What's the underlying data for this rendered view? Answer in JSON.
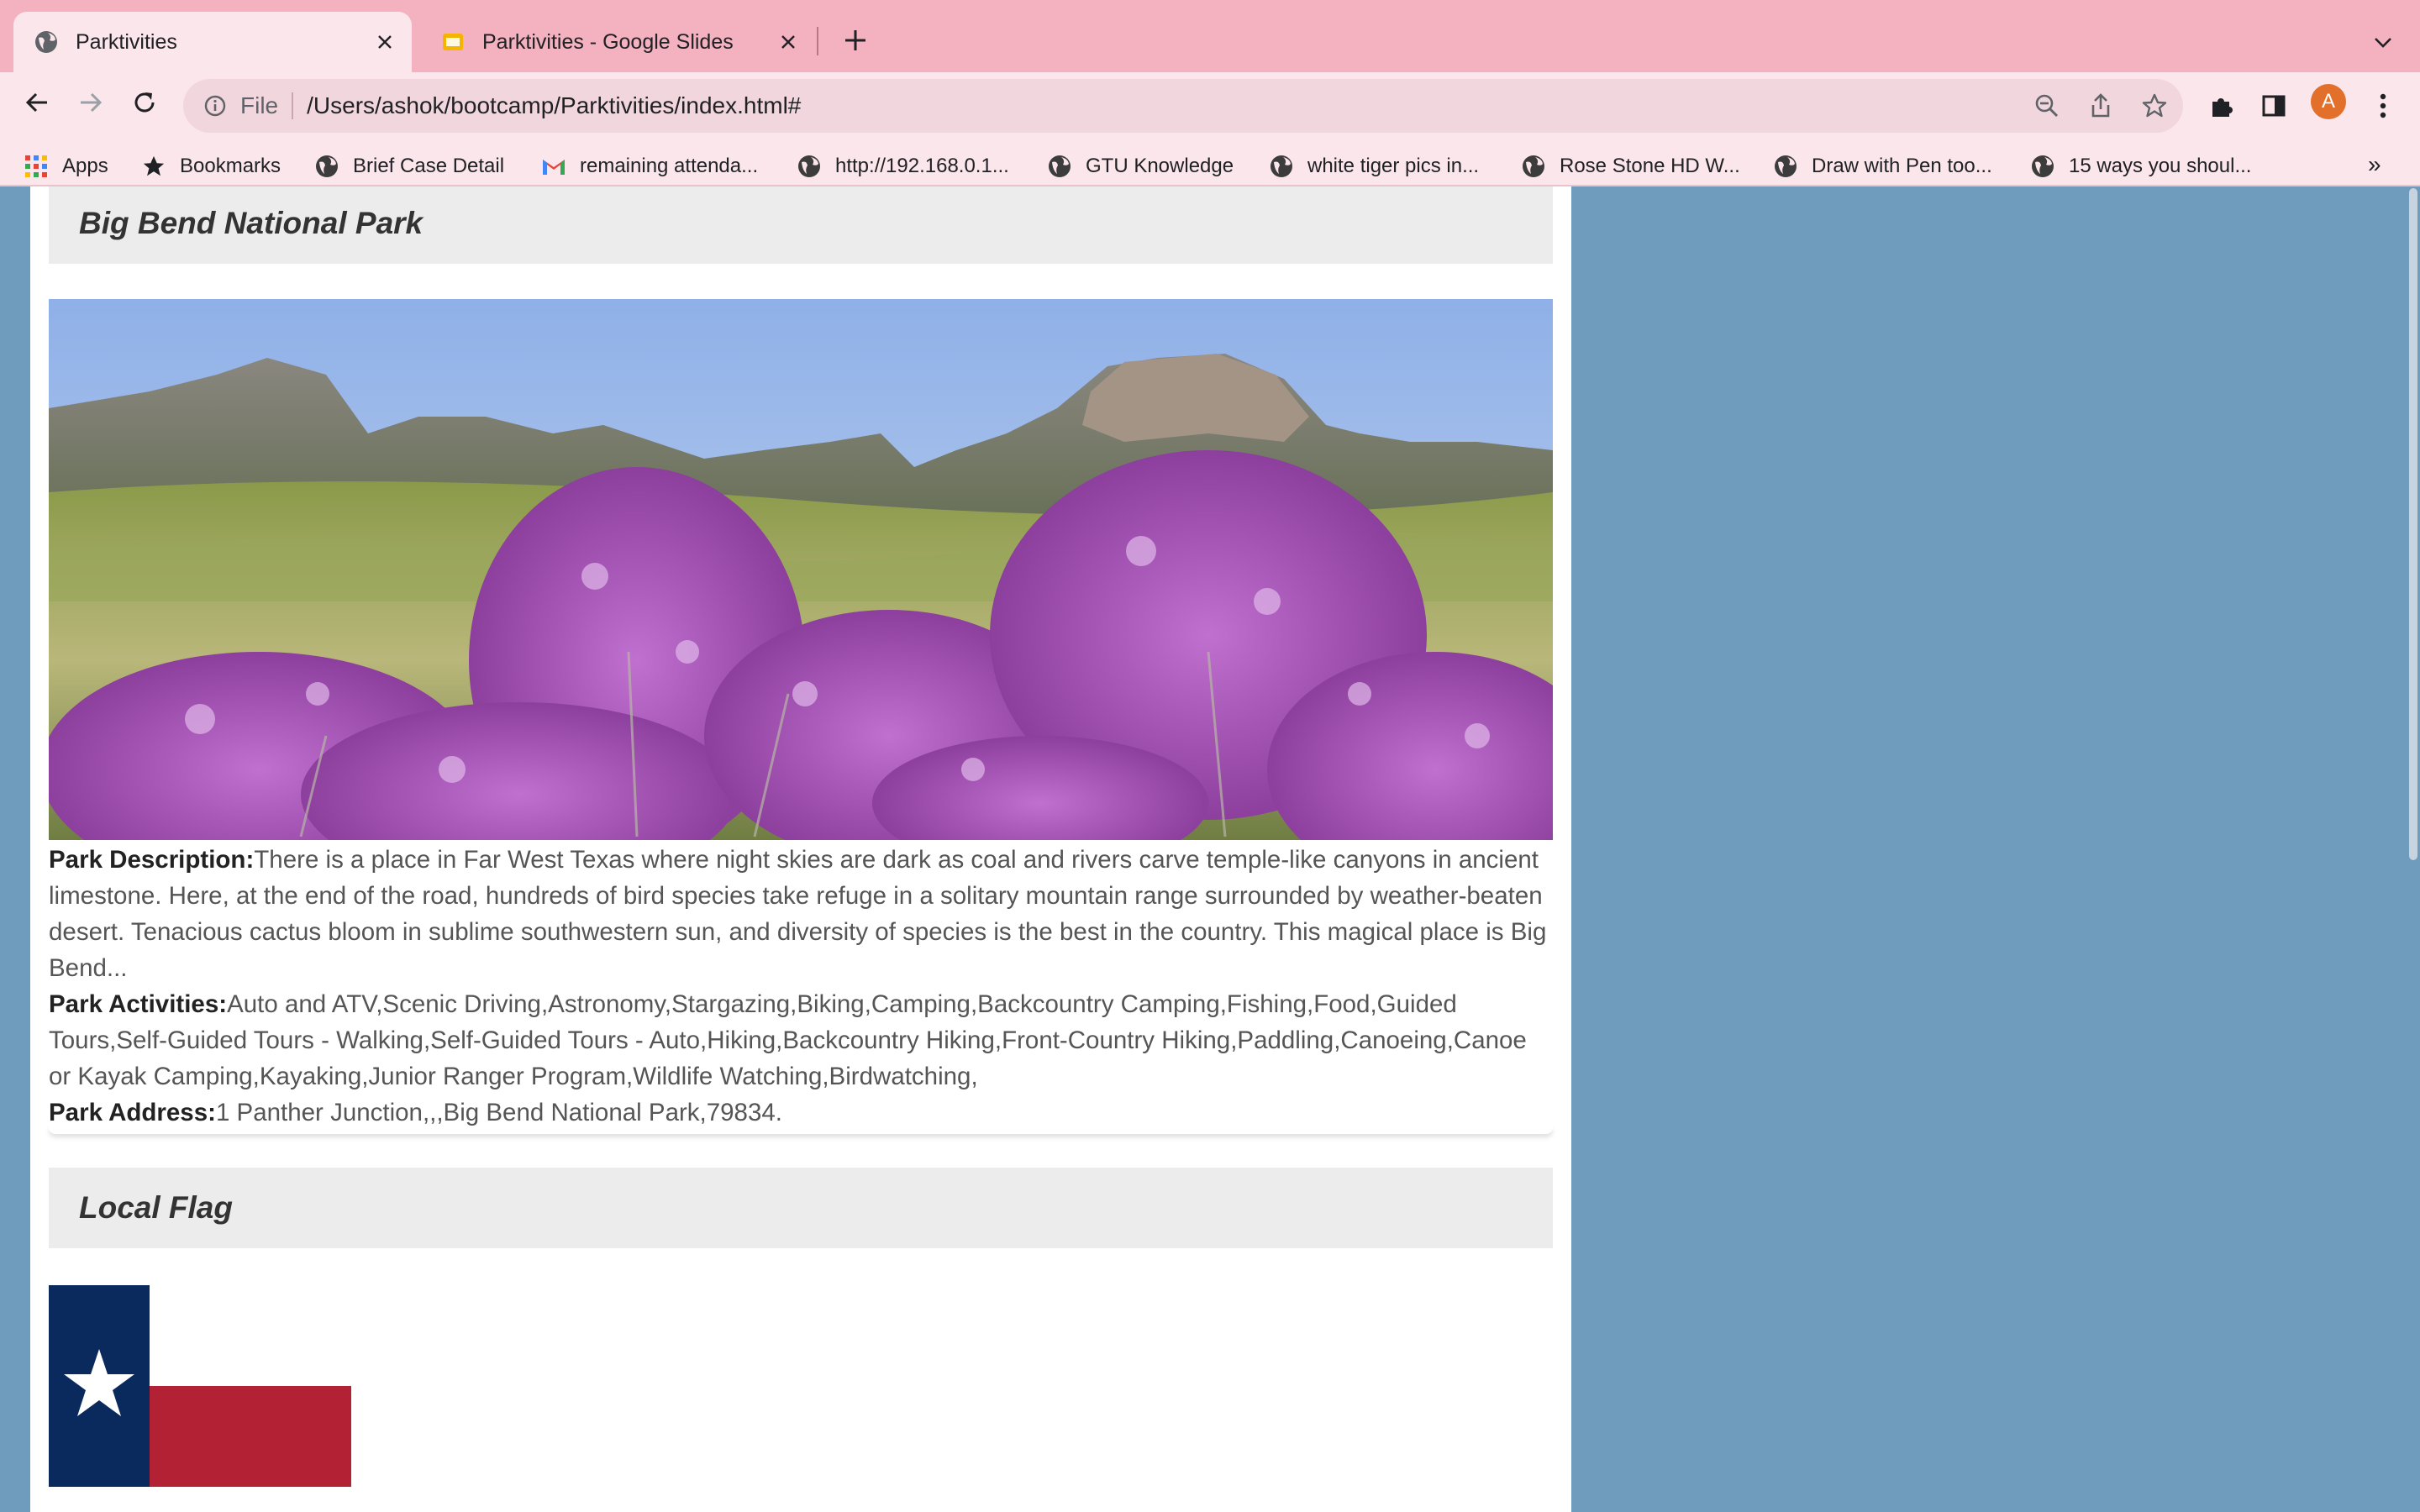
{
  "browser": {
    "tabs": [
      {
        "title": "Parktivities",
        "active": true,
        "icon": "globe-icon"
      },
      {
        "title": "Parktivities - Google Slides",
        "active": false,
        "icon": "slides-icon"
      }
    ],
    "address": {
      "scheme": "File",
      "url": "/Users/ashok/bootcamp/Parktivities/index.html#"
    },
    "profile_initial": "A",
    "bookmarks": [
      {
        "label": "Apps",
        "icon": "apps-grid-icon"
      },
      {
        "label": "Bookmarks",
        "icon": "star-icon"
      },
      {
        "label": "Brief Case Detail",
        "icon": "globe-icon"
      },
      {
        "label": "remaining attenda...",
        "icon": "gmail-icon"
      },
      {
        "label": "http://192.168.0.1...",
        "icon": "globe-icon"
      },
      {
        "label": "GTU Knowledge",
        "icon": "globe-icon"
      },
      {
        "label": "white tiger pics in...",
        "icon": "globe-icon"
      },
      {
        "label": "Rose Stone HD W...",
        "icon": "globe-icon"
      },
      {
        "label": "Draw with Pen too...",
        "icon": "globe-icon"
      },
      {
        "label": "15 ways you shoul...",
        "icon": "globe-icon"
      }
    ],
    "bookmarks_overflow": "»"
  },
  "park": {
    "name": "Big Bend National Park",
    "description_label": "Park Description:",
    "description": "There is a place in Far West Texas where night skies are dark as coal and rivers carve temple-like canyons in ancient limestone. Here, at the end of the road, hundreds of bird species take refuge in a solitary mountain range surrounded by weather-beaten desert. Tenacious cactus bloom in sublime southwestern sun, and diversity of species is the best in the country. This magical place is Big Bend...",
    "activities_label": "Park Activities:",
    "activities": "Auto and ATV,Scenic Driving,Astronomy,Stargazing,Biking,Camping,Backcountry Camping,Fishing,Food,Guided Tours,Self-Guided Tours - Walking,Self-Guided Tours - Auto,Hiking,Backcountry Hiking,Front-Country Hiking,Paddling,Canoeing,Canoe or Kayak Camping,Kayaking,Junior Ranger Program,Wildlife Watching,Birdwatching,",
    "address_label": "Park Address:",
    "address": "1 Panther Junction,,,Big Bend National Park,79834."
  },
  "local_flag": {
    "heading": "Local Flag"
  },
  "colors": {
    "page_background": "#6f9bbd",
    "tab_strip": "#f4b1c0",
    "toolbar": "#fbe6ec",
    "header_card": "#ececec",
    "flag_blue": "#0a2a5e",
    "flag_red": "#b22234"
  }
}
